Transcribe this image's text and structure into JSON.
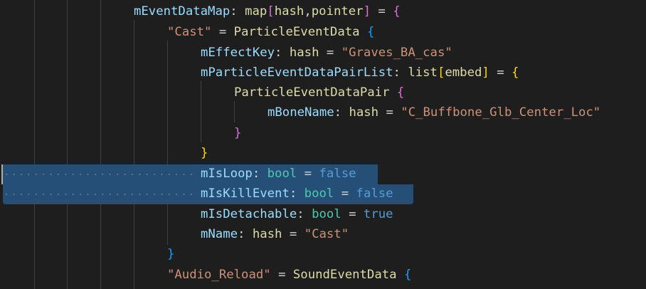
{
  "editor": {
    "lines": [
      {
        "tokens": [
          {
            "text": "mEventDataMap",
            "cls": "k"
          },
          {
            "text": ": ",
            "cls": "o"
          },
          {
            "text": "map",
            "cls": "t"
          },
          {
            "text": "[",
            "cls": "b2"
          },
          {
            "text": "hash",
            "cls": "t"
          },
          {
            "text": ",",
            "cls": "o"
          },
          {
            "text": "pointer",
            "cls": "t"
          },
          {
            "text": "]",
            "cls": "b2"
          },
          {
            "text": " = ",
            "cls": "o"
          },
          {
            "text": "{",
            "cls": "b2"
          }
        ]
      },
      {
        "tokens": [
          {
            "text": "\"Cast\"",
            "cls": "s"
          },
          {
            "text": " = ",
            "cls": "o"
          },
          {
            "text": "ParticleEventData",
            "cls": "t"
          },
          {
            "text": " ",
            "cls": "o"
          },
          {
            "text": "{",
            "cls": "b3"
          }
        ]
      },
      {
        "tokens": [
          {
            "text": "mEffectKey",
            "cls": "k"
          },
          {
            "text": ": ",
            "cls": "o"
          },
          {
            "text": "hash",
            "cls": "t"
          },
          {
            "text": " = ",
            "cls": "o"
          },
          {
            "text": "\"Graves_BA_cas\"",
            "cls": "s"
          }
        ]
      },
      {
        "tokens": [
          {
            "text": "mParticleEventDataPairList",
            "cls": "k"
          },
          {
            "text": ": ",
            "cls": "o"
          },
          {
            "text": "list",
            "cls": "t"
          },
          {
            "text": "[",
            "cls": "b1"
          },
          {
            "text": "embed",
            "cls": "t"
          },
          {
            "text": "]",
            "cls": "b1"
          },
          {
            "text": " = ",
            "cls": "o"
          },
          {
            "text": "{",
            "cls": "b1"
          }
        ]
      },
      {
        "tokens": [
          {
            "text": "ParticleEventDataPair",
            "cls": "t"
          },
          {
            "text": " ",
            "cls": "o"
          },
          {
            "text": "{",
            "cls": "b2"
          }
        ]
      },
      {
        "tokens": [
          {
            "text": "mBoneName",
            "cls": "k"
          },
          {
            "text": ": ",
            "cls": "o"
          },
          {
            "text": "hash",
            "cls": "t"
          },
          {
            "text": " = ",
            "cls": "o"
          },
          {
            "text": "\"C_Buffbone_Glb_Center_Loc\"",
            "cls": "s"
          }
        ]
      },
      {
        "tokens": [
          {
            "text": "}",
            "cls": "b2"
          }
        ]
      },
      {
        "tokens": [
          {
            "text": "}",
            "cls": "b1"
          }
        ]
      },
      {
        "tokens": [
          {
            "text": "mIsLoop",
            "cls": "k"
          },
          {
            "text": ": ",
            "cls": "o"
          },
          {
            "text": "bool",
            "cls": "ts"
          },
          {
            "text": " = ",
            "cls": "o"
          },
          {
            "text": "false",
            "cls": "kw"
          }
        ]
      },
      {
        "tokens": [
          {
            "text": "mIsKillEvent",
            "cls": "k"
          },
          {
            "text": ": ",
            "cls": "o"
          },
          {
            "text": "bool",
            "cls": "ts"
          },
          {
            "text": " = ",
            "cls": "o"
          },
          {
            "text": "false",
            "cls": "kw"
          }
        ]
      },
      {
        "tokens": [
          {
            "text": "mIsDetachable",
            "cls": "k"
          },
          {
            "text": ": ",
            "cls": "o"
          },
          {
            "text": "bool",
            "cls": "ts"
          },
          {
            "text": " = ",
            "cls": "o"
          },
          {
            "text": "true",
            "cls": "kw"
          }
        ]
      },
      {
        "tokens": [
          {
            "text": "mName",
            "cls": "k"
          },
          {
            "text": ": ",
            "cls": "o"
          },
          {
            "text": "hash",
            "cls": "t"
          },
          {
            "text": " = ",
            "cls": "o"
          },
          {
            "text": "\"Cast\"",
            "cls": "s"
          }
        ]
      },
      {
        "tokens": [
          {
            "text": "}",
            "cls": "b3"
          }
        ]
      },
      {
        "tokens": [
          {
            "text": "\"Audio_Reload\"",
            "cls": "s"
          },
          {
            "text": " = ",
            "cls": "o"
          },
          {
            "text": "SoundEventData",
            "cls": "t"
          },
          {
            "text": " ",
            "cls": "o"
          },
          {
            "text": "{",
            "cls": "b3"
          }
        ]
      }
    ]
  },
  "colors": {
    "background": "#1e1e1e",
    "selection": "#264f78",
    "indent_guide": "#404040",
    "property": "#9cdcfe",
    "type": "#dcdcaa",
    "bool_type": "#4ec9b0",
    "string": "#ce9178",
    "keyword": "#569cd6",
    "bracket_gold": "#ffd700",
    "bracket_orchid": "#da70d6",
    "bracket_blue": "#179fff"
  }
}
